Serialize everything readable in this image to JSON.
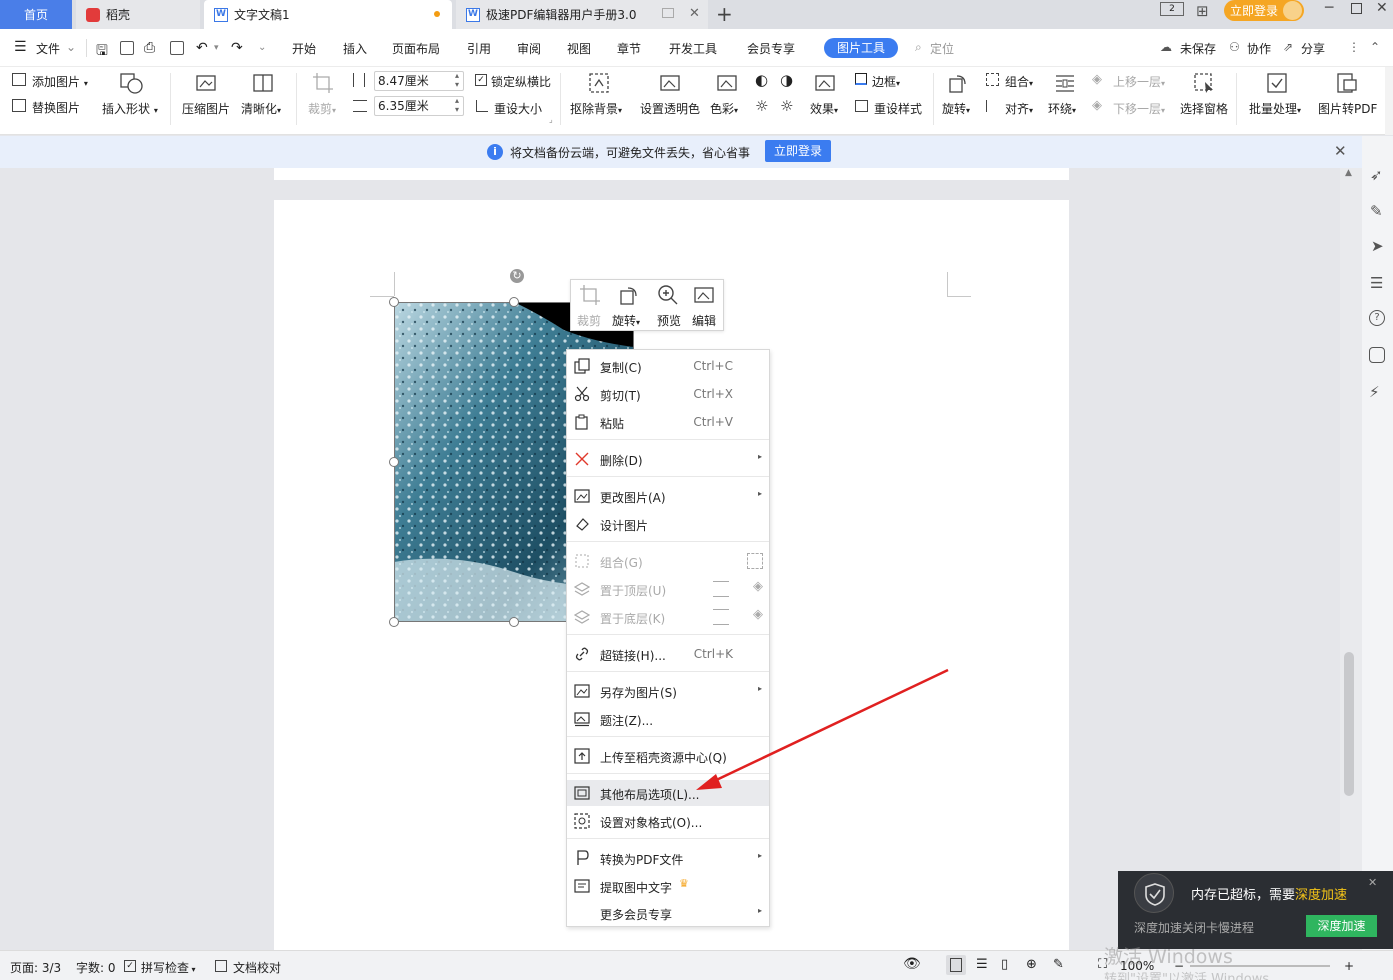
{
  "tabs": {
    "home": "首页",
    "daoke": "稻壳",
    "doc1": "文字文稿1",
    "pdf": "极速PDF编辑器用户手册3.0",
    "add": "+",
    "login": "立即登录"
  },
  "menubar": {
    "file": "文件",
    "items": [
      "开始",
      "插入",
      "页面布局",
      "引用",
      "审阅",
      "视图",
      "章节",
      "开发工具",
      "会员专享"
    ],
    "picture_tools": "图片工具",
    "locate": "定位",
    "unsaved": "未保存",
    "collaborate": "协作",
    "share": "分享"
  },
  "ribbon": {
    "add_picture": "添加图片",
    "replace_picture": "替换图片",
    "insert_shape": "插入形状",
    "compress": "压缩图片",
    "sharpen": "清晰化",
    "crop": "裁剪",
    "width": "8.47厘米",
    "height": "6.35厘米",
    "lock_ratio": "锁定纵横比",
    "reset_size": "重设大小",
    "remove_bg": "抠除背景",
    "set_transparent": "设置透明色",
    "color": "色彩",
    "effects": "效果",
    "border": "边框",
    "reset_style": "重设样式",
    "rotate": "旋转",
    "group": "组合",
    "align": "对齐",
    "wrap": "环绕",
    "bring_forward": "上移一层",
    "send_backward": "下移一层",
    "selection_pane": "选择窗格",
    "batch": "批量处理",
    "to_pdf": "图片转PDF"
  },
  "notice": {
    "text": "将文档备份云端，可避免文件丢失，省心省事",
    "button": "立即登录"
  },
  "mini_toolbar": [
    "裁剪",
    "旋转",
    "预览",
    "编辑"
  ],
  "context_menu": [
    {
      "label": "复制(C)",
      "shortcut": "Ctrl+C"
    },
    {
      "label": "剪切(T)",
      "shortcut": "Ctrl+X"
    },
    {
      "label": "粘贴",
      "shortcut": "Ctrl+V"
    },
    {
      "label": "删除(D)"
    },
    {
      "label": "更改图片(A)"
    },
    {
      "label": "设计图片"
    },
    {
      "label": "组合(G)"
    },
    {
      "label": "置于顶层(U)"
    },
    {
      "label": "置于底层(K)"
    },
    {
      "label": "超链接(H)...",
      "shortcut": "Ctrl+K"
    },
    {
      "label": "另存为图片(S)"
    },
    {
      "label": "题注(Z)..."
    },
    {
      "label": "上传至稻壳资源中心(Q)"
    },
    {
      "label": "其他布局选项(L)..."
    },
    {
      "label": "设置对象格式(O)..."
    },
    {
      "label": "转换为PDF文件"
    },
    {
      "label": "提取图中文字"
    },
    {
      "label": "更多会员专享"
    }
  ],
  "statusbar": {
    "page": "页面: 3/3",
    "words": "字数: 0",
    "spell": "拼写检查",
    "proof": "文档校对",
    "zoom": "100%"
  },
  "popup": {
    "title_pre": "内存已超标，需要",
    "title_highlight": "深度加速",
    "sub": "深度加速关闭卡慢进程",
    "button": "深度加速"
  },
  "watermark": {
    "line1": "激活 Windows",
    "line2": "转到\"设置\"以激活 Windows"
  },
  "colors": {
    "accent": "#3b7cf0",
    "highlight": "#f5c518",
    "arrow": "#e02020"
  }
}
